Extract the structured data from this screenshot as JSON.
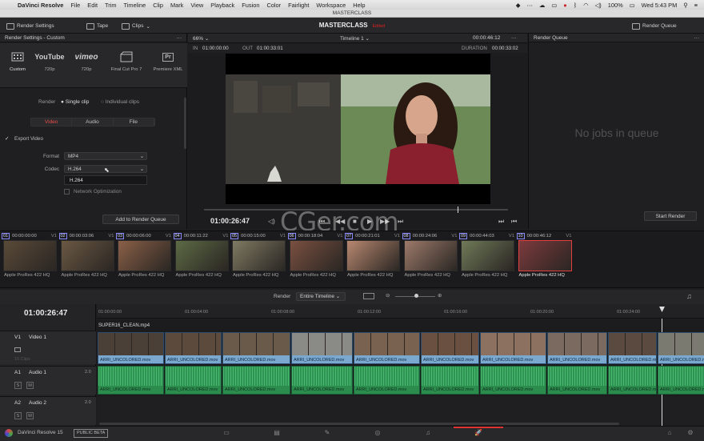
{
  "menubar": {
    "apple_glyph": "",
    "app_name": "DaVinci Resolve",
    "items": [
      "File",
      "Edit",
      "Trim",
      "Timeline",
      "Clip",
      "Mark",
      "View",
      "Playback",
      "Fusion",
      "Color",
      "Fairlight",
      "Workspace",
      "Help"
    ],
    "battery": "100%",
    "clock": "Wed 5:43 PM"
  },
  "window_title": "MASTERCLASS",
  "toolbar": {
    "render_settings": "Render Settings",
    "tape": "Tape",
    "clips": "Clips",
    "project_name": "MASTERCLASS",
    "edited": "Edited",
    "render_queue": "Render Queue"
  },
  "render_settings": {
    "title": "Render Settings - Custom",
    "presets": [
      {
        "icon": "film-strip-icon",
        "label": "Custom",
        "sub": ""
      },
      {
        "icon": "youtube-logo",
        "label": "YouTube",
        "sub": "720p"
      },
      {
        "icon": "vimeo-logo",
        "label": "vimeo",
        "sub": "720p"
      },
      {
        "icon": "final-cut-icon",
        "label": "Final Cut Pro 7",
        "sub": ""
      },
      {
        "icon": "premiere-icon",
        "label": "Premiere XML",
        "sub": ""
      }
    ],
    "render_label": "Render",
    "single_clip": "Single clip",
    "individual_clips": "Individual clips",
    "tabs": [
      "Video",
      "Audio",
      "File"
    ],
    "export_video": "Export Video",
    "format_label": "Format",
    "format_value": "MP4",
    "codec_label": "Codec",
    "codec_value": "H.264",
    "codec_dropdown_option": "H.264",
    "network_optimization": "Network Optimization",
    "add_to_queue": "Add to Render Queue"
  },
  "viewer": {
    "zoom": "66%",
    "timeline_name": "Timeline 1",
    "header_tc": "00:00:46:12",
    "in_label": "IN",
    "in_tc": "01:00:00:00",
    "out_label": "OUT",
    "out_tc": "01:00:33:01",
    "duration_label": "DURATION",
    "duration_tc": "00:00:33:02",
    "current_tc": "01:00:26:47"
  },
  "render_queue": {
    "title": "Render Queue",
    "empty_text": "No jobs in queue",
    "start_render": "Start Render"
  },
  "clips": [
    {
      "num": "01",
      "tc": "00:00:00:00",
      "track": "V1",
      "codec": "Apple ProRes 422 HQ",
      "color": "#5a4a38"
    },
    {
      "num": "02",
      "tc": "00:00:03:06",
      "track": "V1",
      "codec": "Apple ProRes 422 HQ",
      "color": "#6b5843"
    },
    {
      "num": "03",
      "tc": "00:00:06:00",
      "track": "V1",
      "codec": "Apple ProRes 422 HQ",
      "color": "#8a6048"
    },
    {
      "num": "04",
      "tc": "00:00:11:22",
      "track": "V1",
      "codec": "Apple ProRes 422 HQ",
      "color": "#5c6a44"
    },
    {
      "num": "05",
      "tc": "00:00:15:00",
      "track": "V1",
      "codec": "Apple ProRes 422 HQ",
      "color": "#7f7a62"
    },
    {
      "num": "06",
      "tc": "00:00:18:04",
      "track": "V1",
      "codec": "Apple ProRes 422 HQ",
      "color": "#7a5040"
    },
    {
      "num": "07",
      "tc": "00:00:21:01",
      "track": "V1",
      "codec": "Apple ProRes 422 HQ",
      "color": "#b88870"
    },
    {
      "num": "08",
      "tc": "00:00:24:06",
      "track": "V1",
      "codec": "Apple ProRes 422 HQ",
      "color": "#9c7a6a"
    },
    {
      "num": "09",
      "tc": "00:00:44:03",
      "track": "V1",
      "codec": "Apple ProRes 422 HQ",
      "color": "#6f7a58"
    },
    {
      "num": "10",
      "tc": "00:00:46:12",
      "track": "V1",
      "codec": "Apple ProRes 422 HQ",
      "color": "#7c3a3c"
    }
  ],
  "timeline_bar": {
    "render_label": "Render",
    "render_value": "Entire Timeline"
  },
  "timeline": {
    "current_tc": "01:00:26:47",
    "ruler_ticks": [
      "01:00:00:00",
      "01:00:04:00",
      "01:00:08:00",
      "01:00:12:00",
      "01:00:16:00",
      "01:00:20:00",
      "01:00:24:00"
    ],
    "title_clip": "SUPER16_CLEAN.mp4",
    "tracks": {
      "v1": {
        "id": "V1",
        "name": "Video 1",
        "count": "10 Clips"
      },
      "a1": {
        "id": "A1",
        "name": "Audio 1",
        "level": "2.0"
      },
      "a2": {
        "id": "A2",
        "name": "Audio 2",
        "level": "2.0"
      }
    },
    "solo": "S",
    "mute": "M",
    "clip_name": "ARRI_UNCOLORED.mov"
  },
  "bottombar": {
    "app_name": "DaVinci Resolve 15",
    "badge": "PUBLIC BETA"
  },
  "watermark": "CGer.com"
}
